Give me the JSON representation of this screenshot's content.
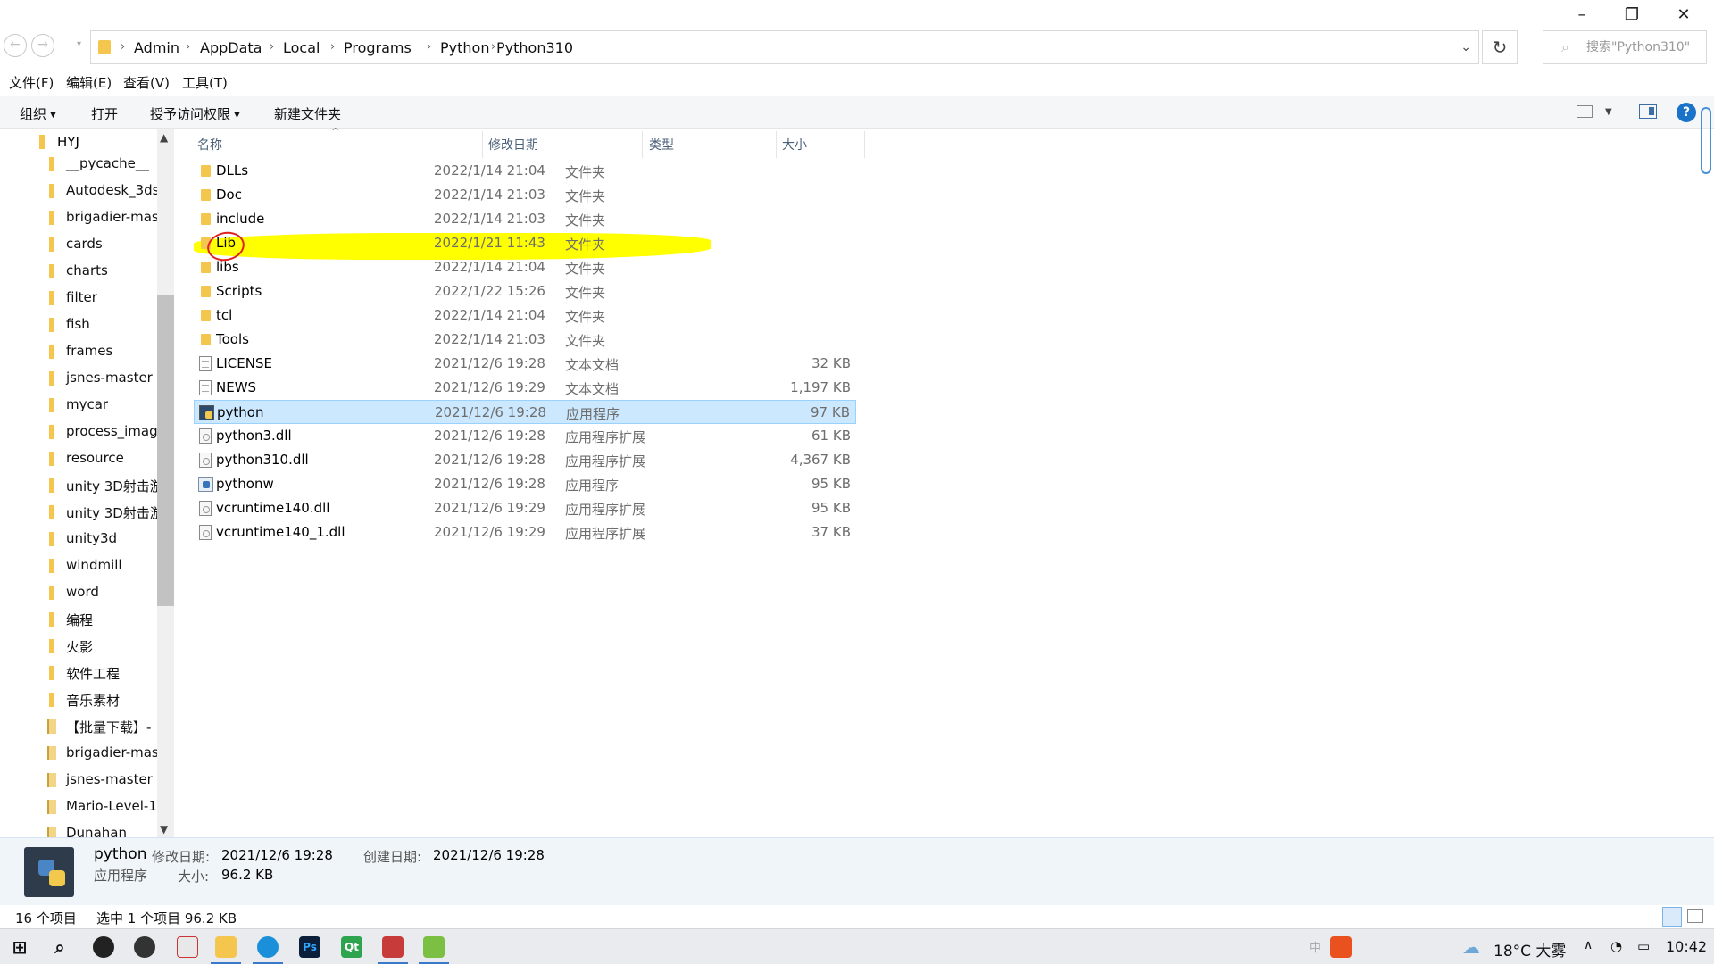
{
  "address": {
    "crumbs": [
      "Admin",
      "AppData",
      "Local",
      "Programs",
      "Python",
      "Python310"
    ],
    "search_placeholder": "搜索\"Python310\""
  },
  "menu": [
    "文件(F)",
    "编辑(E)",
    "查看(V)",
    "工具(T)"
  ],
  "toolbar": {
    "organize": "组织",
    "open": "打开",
    "grant_access": "授予访问权限",
    "new_folder": "新建文件夹"
  },
  "nav": {
    "root": "HYJ",
    "items": [
      {
        "label": "__pycache__",
        "kind": "folder"
      },
      {
        "label": "Autodesk_3ds",
        "kind": "folder"
      },
      {
        "label": "brigadier-mas",
        "kind": "folder"
      },
      {
        "label": "cards",
        "kind": "folder"
      },
      {
        "label": "charts",
        "kind": "folder"
      },
      {
        "label": "filter",
        "kind": "folder"
      },
      {
        "label": "fish",
        "kind": "folder"
      },
      {
        "label": "frames",
        "kind": "folder"
      },
      {
        "label": "jsnes-master",
        "kind": "folder"
      },
      {
        "label": "mycar",
        "kind": "folder"
      },
      {
        "label": "process_imag",
        "kind": "folder"
      },
      {
        "label": "resource",
        "kind": "folder"
      },
      {
        "label": "unity 3D射击游",
        "kind": "folder"
      },
      {
        "label": "unity 3D射击游",
        "kind": "folder"
      },
      {
        "label": "unity3d",
        "kind": "folder"
      },
      {
        "label": "windmill",
        "kind": "folder"
      },
      {
        "label": "word",
        "kind": "folder"
      },
      {
        "label": "编程",
        "kind": "folder"
      },
      {
        "label": "火影",
        "kind": "folder"
      },
      {
        "label": "软件工程",
        "kind": "folder"
      },
      {
        "label": "音乐素材",
        "kind": "folder"
      },
      {
        "label": "【批量下载】-",
        "kind": "zip"
      },
      {
        "label": "brigadier-mas",
        "kind": "zip"
      },
      {
        "label": "jsnes-master",
        "kind": "zip"
      },
      {
        "label": "Mario-Level-1",
        "kind": "zip"
      },
      {
        "label": "Dunahan",
        "kind": "zip"
      }
    ]
  },
  "columns": {
    "name": "名称",
    "date": "修改日期",
    "type": "类型",
    "size": "大小"
  },
  "files": [
    {
      "name": "DLLs",
      "date": "2022/1/14 21:04",
      "type": "文件夹",
      "size": "",
      "icon": "folder"
    },
    {
      "name": "Doc",
      "date": "2022/1/14 21:03",
      "type": "文件夹",
      "size": "",
      "icon": "folder"
    },
    {
      "name": "include",
      "date": "2022/1/14 21:03",
      "type": "文件夹",
      "size": "",
      "icon": "folder"
    },
    {
      "name": "Lib",
      "date": "2022/1/21 11:43",
      "type": "文件夹",
      "size": "",
      "icon": "folder"
    },
    {
      "name": "libs",
      "date": "2022/1/14 21:04",
      "type": "文件夹",
      "size": "",
      "icon": "folder"
    },
    {
      "name": "Scripts",
      "date": "2022/1/22 15:26",
      "type": "文件夹",
      "size": "",
      "icon": "folder"
    },
    {
      "name": "tcl",
      "date": "2022/1/14 21:04",
      "type": "文件夹",
      "size": "",
      "icon": "folder"
    },
    {
      "name": "Tools",
      "date": "2022/1/14 21:03",
      "type": "文件夹",
      "size": "",
      "icon": "folder"
    },
    {
      "name": "LICENSE",
      "date": "2021/12/6 19:28",
      "type": "文本文档",
      "size": "32 KB",
      "icon": "doc"
    },
    {
      "name": "NEWS",
      "date": "2021/12/6 19:29",
      "type": "文本文档",
      "size": "1,197 KB",
      "icon": "doc"
    },
    {
      "name": "python",
      "date": "2021/12/6 19:28",
      "type": "应用程序",
      "size": "97 KB",
      "icon": "py"
    },
    {
      "name": "python3.dll",
      "date": "2021/12/6 19:28",
      "type": "应用程序扩展",
      "size": "61 KB",
      "icon": "dll"
    },
    {
      "name": "python310.dll",
      "date": "2021/12/6 19:28",
      "type": "应用程序扩展",
      "size": "4,367 KB",
      "icon": "dll"
    },
    {
      "name": "pythonw",
      "date": "2021/12/6 19:28",
      "type": "应用程序",
      "size": "95 KB",
      "icon": "pyw"
    },
    {
      "name": "vcruntime140.dll",
      "date": "2021/12/6 19:29",
      "type": "应用程序扩展",
      "size": "95 KB",
      "icon": "dll"
    },
    {
      "name": "vcruntime140_1.dll",
      "date": "2021/12/6 19:29",
      "type": "应用程序扩展",
      "size": "37 KB",
      "icon": "dll"
    }
  ],
  "selected_index": 10,
  "details": {
    "name": "python",
    "type": "应用程序",
    "modified_label": "修改日期:",
    "modified_value": "2021/12/6 19:28",
    "created_label": "创建日期:",
    "created_value": "2021/12/6 19:28",
    "size_label": "大小:",
    "size_value": "96.2 KB"
  },
  "status": {
    "count": "16 个项目",
    "selection": "选中 1 个项目  96.2 KB"
  },
  "taskbar": {
    "ime": "中",
    "weather": "18°C  大雾",
    "time": "10:42"
  },
  "colors": {
    "selection": "#cce8ff",
    "highlight": "#ffff00",
    "annotation": "#e02020",
    "folder": "#f4c64e"
  }
}
